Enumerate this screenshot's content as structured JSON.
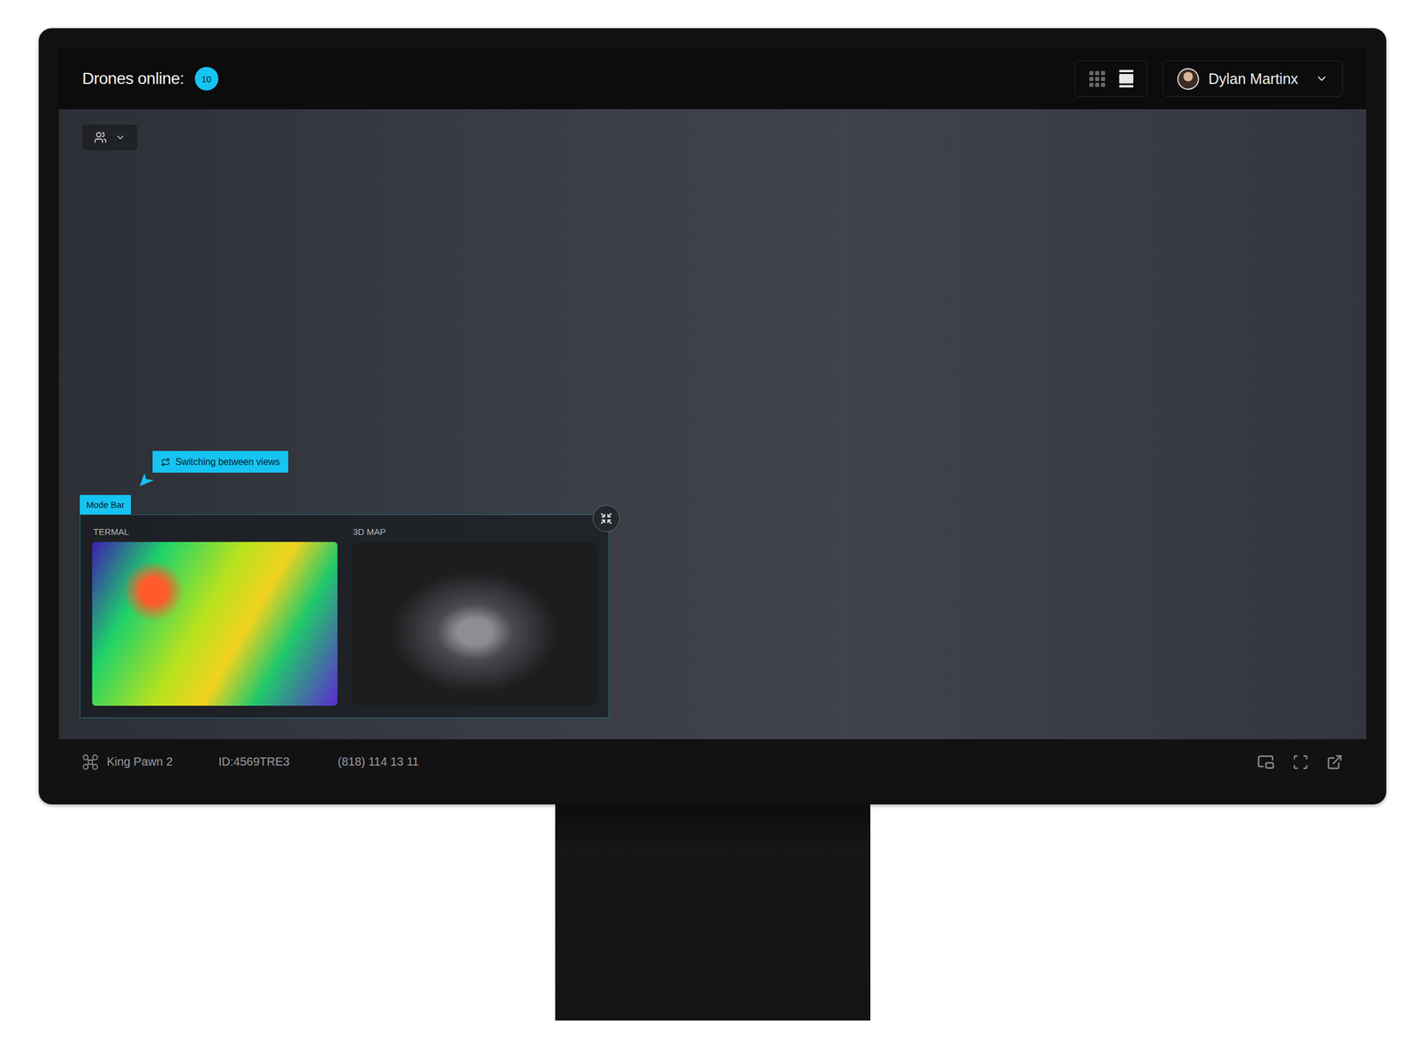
{
  "header": {
    "title": "Drones online:",
    "count": "10"
  },
  "view_toggle": [
    {
      "kind": "grid",
      "selected": false
    },
    {
      "kind": "list",
      "selected": true
    }
  ],
  "user": {
    "name": "Dylan Martinx"
  },
  "mode_bar": {
    "label": "Mode Bar",
    "tooltip": "Switching between views",
    "views": [
      {
        "title": "TERMAL",
        "kind": "thermal"
      },
      {
        "title": "3D MAP",
        "kind": "map"
      }
    ]
  },
  "footer": {
    "drone_name": "King Pawn 2",
    "id": "ID:4569TRE3",
    "phone": "(818) 114 13 11"
  }
}
